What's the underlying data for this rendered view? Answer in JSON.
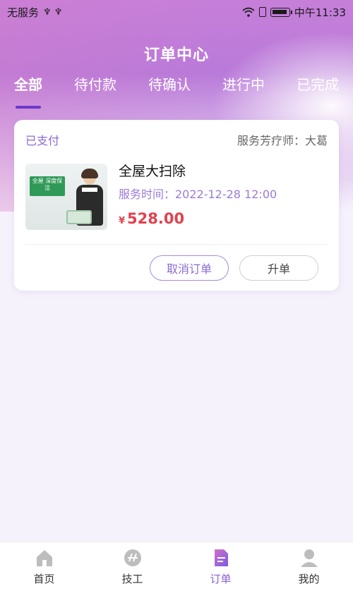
{
  "status_bar": {
    "carrier": "无服务",
    "usb_symbols": "♆ ♆",
    "time": "中午11:33"
  },
  "header": {
    "title": "订单中心",
    "tabs": [
      {
        "label": "全部",
        "active": true
      },
      {
        "label": "待付款",
        "active": false
      },
      {
        "label": "待确认",
        "active": false
      },
      {
        "label": "进行中",
        "active": false
      },
      {
        "label": "已完成",
        "active": false
      }
    ]
  },
  "order": {
    "status": "已支付",
    "therapist": "服务芳疗师：大葛",
    "service_name": "全屋大扫除",
    "service_time": "服务时间：2022-12-28 12:00",
    "currency": "¥",
    "price": "528.00",
    "thumb_badge": "全屋 深度保洁",
    "buttons": {
      "cancel": "取消订单",
      "upgrade": "升单"
    }
  },
  "tabbar": {
    "items": [
      {
        "label": "首页",
        "icon": "home-icon"
      },
      {
        "label": "技工",
        "icon": "worker-icon"
      },
      {
        "label": "订单",
        "icon": "order-icon",
        "active": true
      },
      {
        "label": "我的",
        "icon": "profile-icon"
      }
    ]
  },
  "colors": {
    "accent": "#8a5fd6",
    "price": "#e0424d",
    "header_gradient_start": "#c67fd9"
  }
}
